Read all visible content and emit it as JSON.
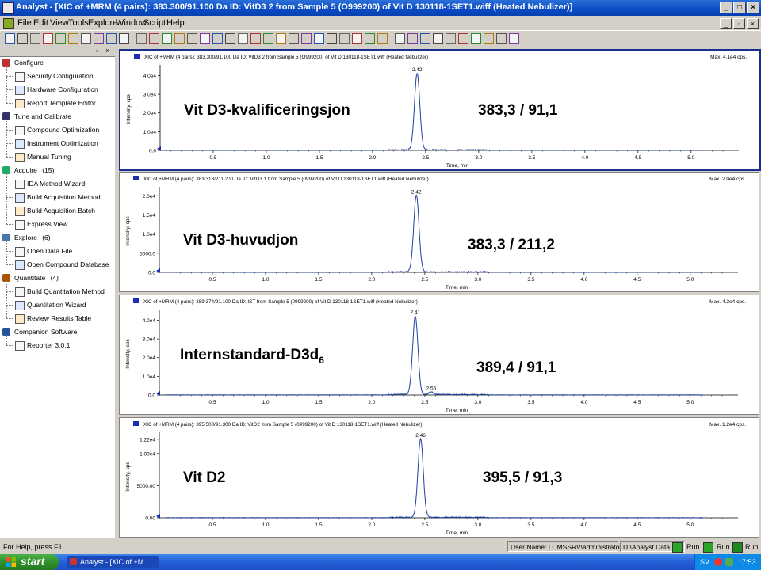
{
  "window": {
    "title": "Analyst - [XIC of +MRM (4 pairs): 383.300/91.100 Da ID: VitD3 2 from Sample 5 (O999200) of Vit D 130118-1SET1.wiff (Heated Nebulizer)]"
  },
  "menu": [
    "File",
    "Edit",
    "View",
    "Tools",
    "Explore",
    "Window",
    "Script",
    "Help"
  ],
  "nav": {
    "groups": [
      {
        "label": "Configure",
        "items": [
          "Security Configuration",
          "Hardware Configuration",
          "Report Template Editor"
        ]
      },
      {
        "label": "Tune and Calibrate",
        "items": [
          "Compound Optimization",
          "Instrument Optimization",
          "Manual Tuning"
        ]
      },
      {
        "label": "Acquire",
        "count": "(15)",
        "items": [
          "IDA Method Wizard",
          "Build Acquisition Method",
          "Build Acquisition Batch",
          "Express View"
        ]
      },
      {
        "label": "Explore",
        "count": "(6)",
        "items": [
          "Open Data File",
          "Open Compound Database"
        ]
      },
      {
        "label": "Quantitate",
        "count": "(4)",
        "items": [
          "Build Quantitation Method",
          "Quantitation Wizard",
          "Review Results Table"
        ]
      },
      {
        "label": "Companion Software",
        "items": [
          "Reporter 3.0.1"
        ]
      }
    ]
  },
  "chart_data": [
    {
      "type": "line",
      "header": "XIC of +MRM (4 pairs): 383.300/91.100 Da ID: VitD3 2 from Sample 5 (O999200) of Vit D 130118-1SET1.wiff (Heated Nebulizer)",
      "max_label": "Max. 4.1e4 cps.",
      "annotation": "Vit D3-kvalificeringsjon",
      "transition": "383,3 / 91,1",
      "ylabel": "Intensity, cps",
      "xlabel": "Time, min",
      "x_ticks": [
        "0.5",
        "1.0",
        "1.5",
        "2.0",
        "2.5",
        "3.0",
        "3.5",
        "4.0",
        "4.5",
        "5.0"
      ],
      "y_ticks": [
        "4.0e4",
        "3.0e4",
        "2.0e4",
        "1.0e4",
        "0.0"
      ],
      "xlim": [
        0,
        5.3
      ],
      "ylim": [
        0,
        44000
      ],
      "peaks": [
        {
          "rt": 2.42,
          "height": 41000,
          "label": "2.42"
        }
      ]
    },
    {
      "type": "line",
      "header": "XIC of +MRM (4 pairs): 383.313/211.200 Da ID: VitD3 1 from Sample 5 (0999200) of Vit D 130118-1SET1.wiff (Heated Nebulizer)",
      "max_label": "Max. 2.0e4 cps.",
      "annotation": "Vit D3-huvudjon",
      "transition": "383,3 / 211,2",
      "ylabel": "Intensity, cps",
      "xlabel": "Time, min",
      "x_ticks": [
        "0.5",
        "1.0",
        "1.5",
        "2.0",
        "2.5",
        "3.0",
        "3.5",
        "4.0",
        "4.5",
        "5.0"
      ],
      "y_ticks": [
        "2.0e4",
        "1.5e4",
        "1.0e4",
        "5000.0",
        "0.0"
      ],
      "xlim": [
        0,
        5.3
      ],
      "ylim": [
        0,
        21500
      ],
      "peaks": [
        {
          "rt": 2.42,
          "height": 20000,
          "label": "2.42"
        }
      ]
    },
    {
      "type": "line",
      "header": "XIC of +MRM (4 pairs): 389.374/91.100 Da ID: IST from Sample 5 (0999200) of Vit D 130118-1SET1.wiff (Heated Nebulizer)",
      "max_label": "Max. 4.2e4 cps.",
      "annotation": "Internstandard-D3d",
      "annotation_sub": "6",
      "transition": "389,4 / 91,1",
      "ylabel": "Intensity, cps",
      "xlabel": "Time, min",
      "x_ticks": [
        "0.5",
        "1.0",
        "1.5",
        "2.0",
        "2.5",
        "3.0",
        "3.5",
        "4.0",
        "4.5",
        "5.0"
      ],
      "y_ticks": [
        "4.0e4",
        "3.0e4",
        "2.0e4",
        "1.0e4",
        "0.0"
      ],
      "xlim": [
        0,
        5.3
      ],
      "ylim": [
        0,
        44000
      ],
      "peaks": [
        {
          "rt": 2.41,
          "height": 42000,
          "label": "2.41"
        },
        {
          "rt": 2.56,
          "height": 1500,
          "label": "2.56"
        }
      ]
    },
    {
      "type": "line",
      "header": "XIC of +MRM (4 pairs): 395.500/91.300 Da ID: VitD2 from Sample 5 (0999200) of Vit D 130118-1SET1.wiff (Heated Nebulizer)",
      "max_label": "Max. 1.2e4 cps.",
      "annotation": "Vit D2",
      "transition": "395,5 / 91,3",
      "ylabel": "Intensity, cps",
      "xlabel": "Time, min",
      "x_ticks": [
        "0.5",
        "1.0",
        "1.5",
        "2.0",
        "2.5",
        "3.0",
        "3.5",
        "4.0",
        "4.5",
        "5.0"
      ],
      "y_ticks": [
        "1.22e4",
        "1.00e4",
        "5000.00",
        "0.00"
      ],
      "xlim": [
        0,
        5.3
      ],
      "ylim": [
        0,
        12800
      ],
      "peaks": [
        {
          "rt": 2.46,
          "height": 12200,
          "label": "2.46"
        }
      ]
    }
  ],
  "status": {
    "help": "For Help, press F1",
    "user": "User Name: LCMSSRV\\administrator",
    "path": "D:\\Analyst Data",
    "run1": "Run",
    "run2": "Run",
    "run3": "Run"
  },
  "taskbar": {
    "start": "start",
    "item": "Analyst - [XIC of +M...",
    "lang": "SV",
    "time": "17:53"
  },
  "colors": {
    "trace": "#1f3fa0",
    "active_border": "#1c2d8c",
    "title_blue": "#0a4bc4"
  }
}
